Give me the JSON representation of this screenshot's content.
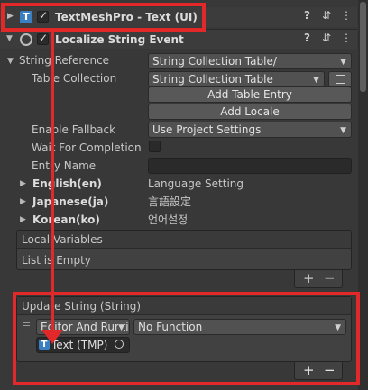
{
  "components": {
    "tmp_title": "TextMeshPro - Text (UI)",
    "localize_title": "Localize String Event",
    "tmp_icon_glyph": "T",
    "menu_glyph": "⋮",
    "help_glyph": "?",
    "preset_glyph": "⇵"
  },
  "string_reference": {
    "label": "String Reference",
    "value": "String Collection Table/",
    "table_collection_label": "Table Collection",
    "table_collection_value": "String Collection Table",
    "add_table_entry": "Add Table Entry",
    "add_locale": "Add Locale",
    "enable_fallback_label": "Enable Fallback",
    "enable_fallback_value": "Use Project Settings",
    "wait_for_completion_label": "Wait For Completion",
    "entry_name_label": "Entry Name",
    "entry_name_value": "",
    "locales": [
      {
        "label": "English(en)",
        "value": "Language Setting"
      },
      {
        "label": "Japanese(ja)",
        "value": "言語設定"
      },
      {
        "label": "Korean(ko)",
        "value": "언어설정"
      }
    ]
  },
  "local_variables": {
    "header": "Local Variables",
    "empty_text": "List is Empty",
    "plus": "+",
    "minus": "−"
  },
  "update_string": {
    "header": "Update String (String)",
    "runtime_value": "Editor And Runtime",
    "function_value": "No Function",
    "target_value": "Text (TMP)",
    "plus": "+",
    "minus": "−"
  },
  "colors": {
    "background": "#383838",
    "highlight": "#e22828",
    "icon_blue": "#3a7fc2"
  }
}
